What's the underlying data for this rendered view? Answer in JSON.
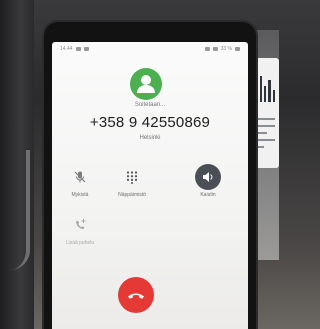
{
  "status_bar": {
    "time": "14.44",
    "battery": "33 %"
  },
  "call": {
    "state": "Soitetaan...",
    "number": "+358 9 42550869",
    "location": "Helsinki"
  },
  "controls": {
    "mute_label": "Mykistä",
    "keypad_label": "Näppäimistö",
    "speaker_label": "Kaiutin",
    "add_call_label": "Lisää puhelu"
  },
  "colors": {
    "avatar": "#4caf50",
    "end_call": "#e53935",
    "speaker_active": "#4a4f55"
  }
}
